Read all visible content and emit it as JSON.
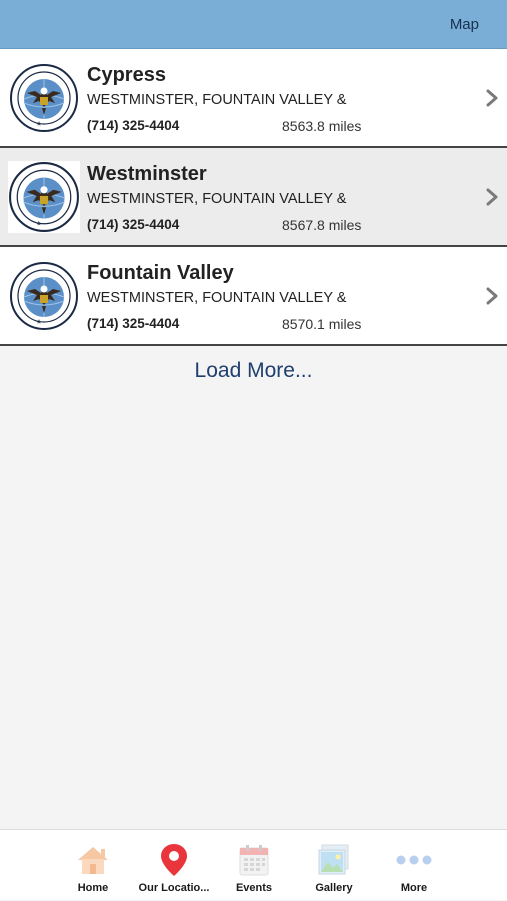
{
  "header": {
    "map_label": "Map"
  },
  "locations": [
    {
      "title": "Cypress",
      "address": "WESTMINSTER, FOUNTAIN VALLEY &",
      "phone": "(714) 325-4404",
      "distance": "8563.8 miles"
    },
    {
      "title": "Westminster",
      "address": "WESTMINSTER, FOUNTAIN VALLEY &",
      "phone": "(714) 325-4404",
      "distance": "8567.8 miles"
    },
    {
      "title": "Fountain Valley",
      "address": "WESTMINSTER, FOUNTAIN VALLEY &",
      "phone": "(714) 325-4404",
      "distance": "8570.1 miles"
    }
  ],
  "load_more_label": "Load More...",
  "logo": {
    "top_text": "TOMMY'S TAEKWONDO",
    "right_text": "ACADEMY"
  },
  "tabs": [
    {
      "label": "Home",
      "icon": "home-icon"
    },
    {
      "label": "Our Locatio...",
      "icon": "location-pin-icon"
    },
    {
      "label": "Events",
      "icon": "calendar-icon"
    },
    {
      "label": "Gallery",
      "icon": "gallery-icon"
    },
    {
      "label": "More",
      "icon": "more-dots-icon"
    }
  ],
  "colors": {
    "header_bg": "#7aaed6",
    "accent_text": "#1f3f6e",
    "pin_red": "#e8363c"
  }
}
